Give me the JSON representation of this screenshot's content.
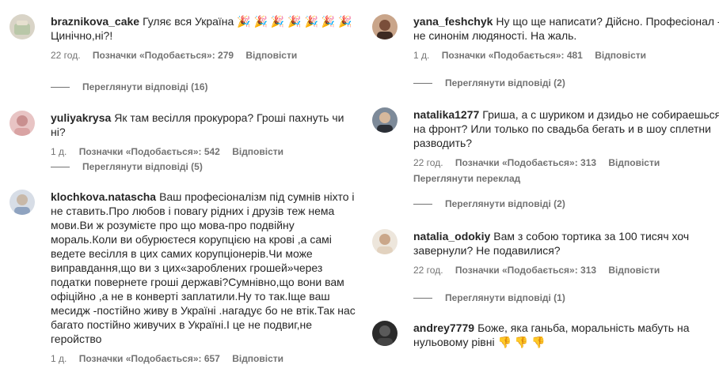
{
  "left": [
    {
      "user": "braznikova_cake",
      "text": "Гуляє вся Україна 🎉 🎉 🎉 🎉 🎉 🎉 🎉\nЦинічно,ні?!",
      "time": "22 год.",
      "likes": "Позначки «Подобається»: 279",
      "reply": "Відповісти",
      "replies": "Переглянути відповіді (16)"
    },
    {
      "user": "yuliyakrysa",
      "text": "Як там весілля прокурора? Гроші пахнуть чи ні?",
      "time": "1 д.",
      "likes": "Позначки «Подобається»: 542",
      "reply": "Відповісти",
      "replies": "Переглянути відповіді (5)"
    },
    {
      "user": "klochkova.natascha",
      "text": "Ваш професіоналізм під сумнів ніхто і не ставить.Про любов і повагу рідних і друзів теж нема мови.Ви ж розумієте про що мова-про подвійну мораль.Коли ви обурюєтеся корупцією на крові ,а самі ведете весілля в цих самих корупціонерів.Чи може виправдання,що ви з цих«зароблених грошей»через податки повернете гроші державі?Сумнівно,що вони вам офіційно ,а не в конверті заплатили.Ну то так.Іще ваш месидж -постійно живу в Україні .нагадує бо не втік.Так нас багато постійно живучих в Україні.І це не подвиг,не геройство",
      "time": "1 д.",
      "likes": "Позначки «Подобається»: 657",
      "reply": "Відповісти"
    }
  ],
  "right": [
    {
      "user": "yana_feshchyk",
      "text": "Ну що ще написати? Дійсно. Професіонал - не синонім людяності. На жаль.",
      "time": "1 д.",
      "likes": "Позначки «Подобається»: 481",
      "reply": "Відповісти",
      "replies": "Переглянути відповіді (2)"
    },
    {
      "user": "natalika1277",
      "text": "Гриша, а с шуриком и дзидьо не собираешься на фронт? Или только по свадьба бегать и в шоу сплетни разводить?",
      "time": "22 год.",
      "likes": "Позначки «Подобається»: 313",
      "reply": "Відповісти",
      "translate": "Переглянути переклад",
      "replies": "Переглянути відповіді (2)"
    },
    {
      "user": "natalia_odokiy",
      "text": "Вам з собою тортика за 100 тисяч хоч завернули? Не подавилися?",
      "time": "22 год.",
      "likes": "Позначки «Подобається»: 313",
      "reply": "Відповісти",
      "replies": "Переглянути відповіді (1)"
    },
    {
      "user": "andrey7779",
      "text": "Боже, яка ганьба, моральність мабуть на нульовому рівні 👎 👎 👎"
    }
  ],
  "colors": {
    "text": "#262626",
    "secondary": "#737373",
    "background": "#ffffff"
  }
}
